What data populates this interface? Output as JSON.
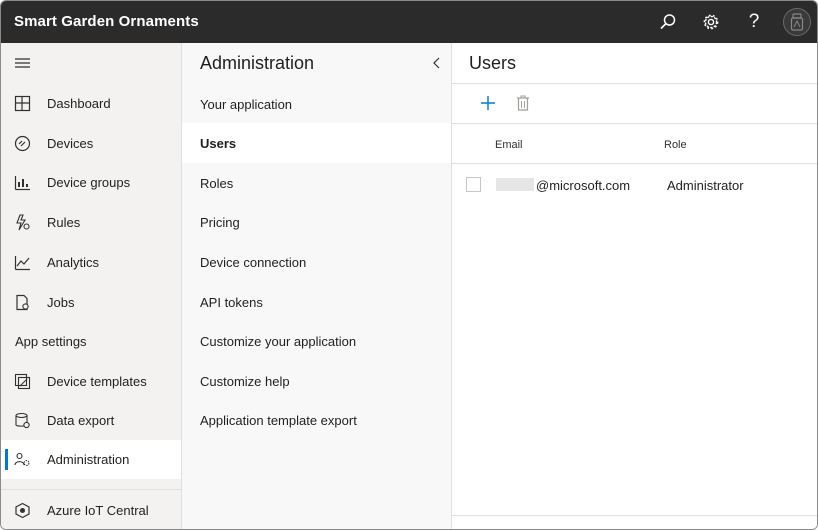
{
  "app": {
    "title": "Smart Garden Ornaments"
  },
  "topbar": {
    "icons": [
      "search-icon",
      "settings-gear-icon",
      "help-icon",
      "account-avatar-icon"
    ],
    "help_glyph": "?"
  },
  "nav": {
    "items": [
      {
        "label": "Dashboard",
        "icon": "dashboard-icon"
      },
      {
        "label": "Devices",
        "icon": "devices-icon"
      },
      {
        "label": "Device groups",
        "icon": "device-groups-icon"
      },
      {
        "label": "Rules",
        "icon": "rules-icon"
      },
      {
        "label": "Analytics",
        "icon": "analytics-icon"
      },
      {
        "label": "Jobs",
        "icon": "jobs-icon"
      }
    ],
    "section_label": "App settings",
    "settings_items": [
      {
        "label": "Device templates",
        "icon": "device-templates-icon"
      },
      {
        "label": "Data export",
        "icon": "data-export-icon"
      },
      {
        "label": "Administration",
        "icon": "administration-icon",
        "active": true
      }
    ],
    "footer": {
      "label": "Azure IoT Central",
      "icon": "azure-iot-central-icon"
    }
  },
  "admin": {
    "title": "Administration",
    "items": [
      {
        "label": "Your application"
      },
      {
        "label": "Users",
        "active": true
      },
      {
        "label": "Roles"
      },
      {
        "label": "Pricing"
      },
      {
        "label": "Device connection"
      },
      {
        "label": "API tokens"
      },
      {
        "label": "Customize your application"
      },
      {
        "label": "Customize help"
      },
      {
        "label": "Application template export"
      }
    ]
  },
  "users": {
    "title": "Users",
    "columns": {
      "email": "Email",
      "role": "Role"
    },
    "rows": [
      {
        "email": "@microsoft.com",
        "role": "Administrator"
      }
    ]
  },
  "colors": {
    "topbar": "#2b2b2b",
    "accent": "#0078d4",
    "nav_bg": "#f3f2f1"
  }
}
